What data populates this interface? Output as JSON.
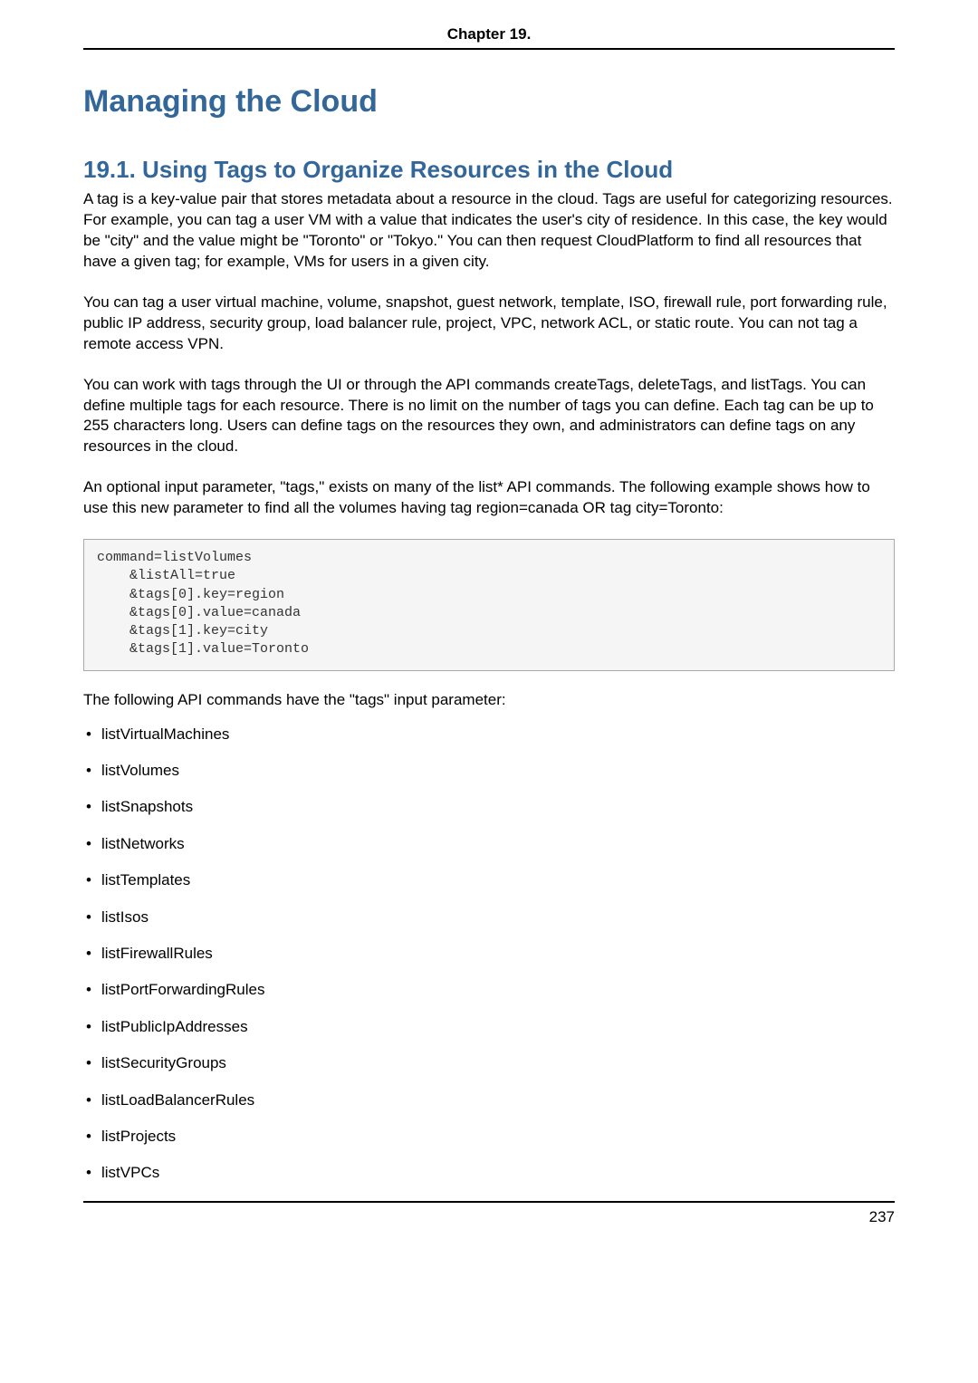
{
  "header": {
    "chapter_label": "Chapter 19."
  },
  "title": "Managing the Cloud",
  "section": {
    "number_title": "19.1. Using Tags to Organize Resources in the Cloud",
    "p1": "A tag is a key-value pair that stores metadata about a resource in the cloud. Tags are useful for categorizing resources. For example, you can tag a user VM with a value that indicates the user's city of residence. In this case, the key would be \"city\" and the value might be \"Toronto\" or \"Tokyo.\" You can then request CloudPlatform to find all resources that have a given tag; for example, VMs for users in a given city.",
    "p2": "You can tag a user virtual machine, volume, snapshot, guest network, template, ISO, firewall rule, port forwarding rule, public IP address, security group, load balancer rule, project, VPC, network ACL, or static route. You can not tag a remote access VPN.",
    "p3": "You can work with tags through the UI or through the API commands createTags, deleteTags, and listTags. You can define multiple tags for each resource. There is no limit on the number of tags you can define. Each tag can be up to 255 characters long. Users can define tags on the resources they own, and administrators can define tags on any resources in the cloud.",
    "p4": "An optional input parameter, \"tags,\" exists on many of the list* API commands. The following example shows how to use this new parameter to find all the volumes having tag region=canada OR tag city=Toronto:",
    "code": "command=listVolumes\n    &listAll=true\n    &tags[0].key=region\n    &tags[0].value=canada\n    &tags[1].key=city\n    &tags[1].value=Toronto",
    "p5": "The following API commands have the \"tags\" input parameter:",
    "api_cmds": [
      "listVirtualMachines",
      "listVolumes",
      "listSnapshots",
      "listNetworks",
      "listTemplates",
      "listIsos",
      "listFirewallRules",
      "listPortForwardingRules",
      "listPublicIpAddresses",
      "listSecurityGroups",
      "listLoadBalancerRules",
      "listProjects",
      "listVPCs"
    ]
  },
  "footer": {
    "page_number": "237"
  }
}
